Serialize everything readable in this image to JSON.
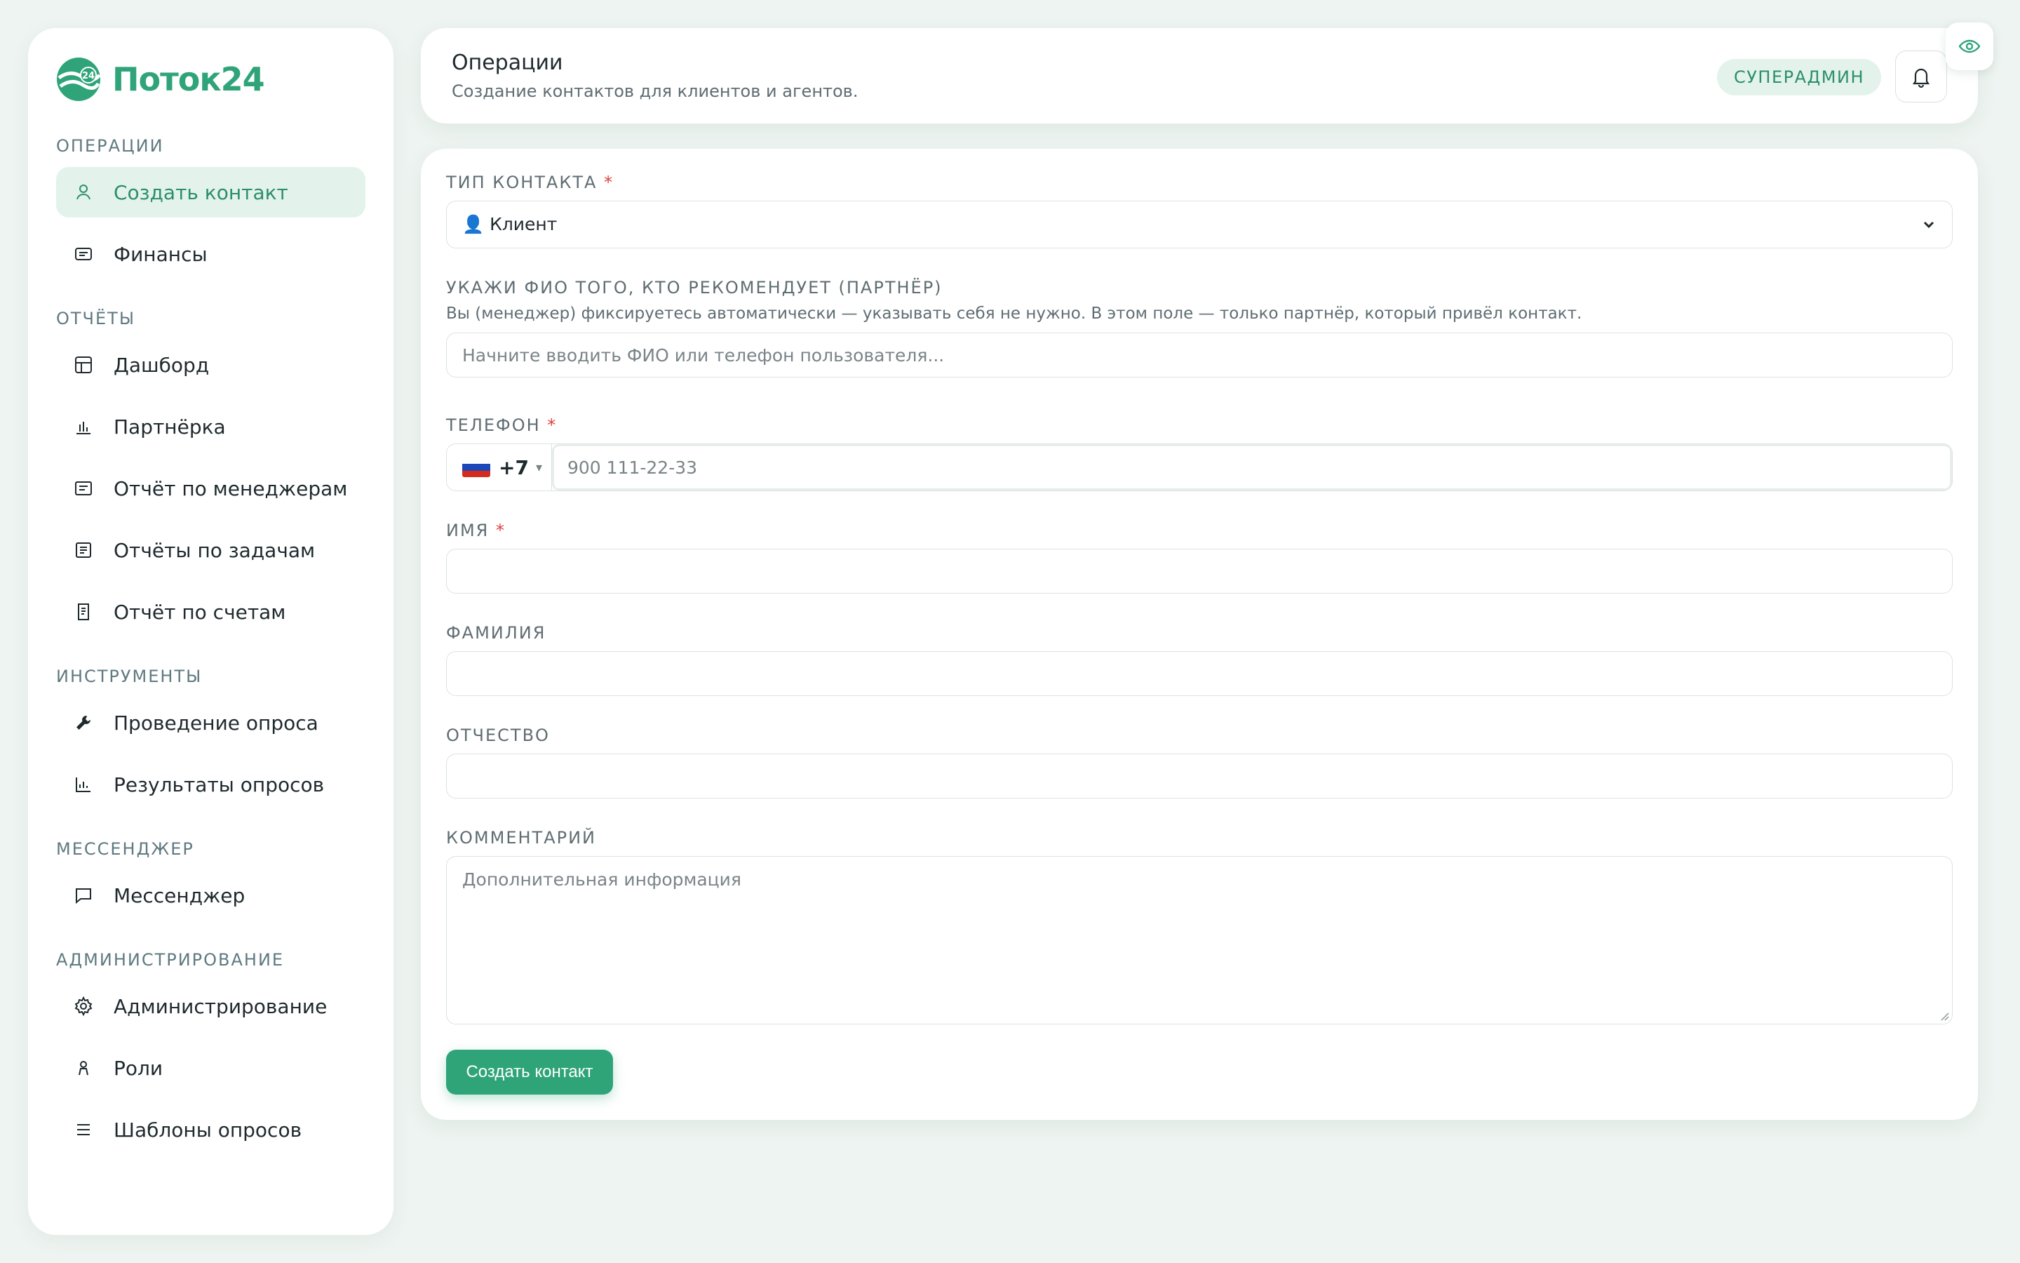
{
  "brand": {
    "name": "Поток24",
    "badge": "24",
    "color": "#2fa479"
  },
  "sidebar": {
    "sections": [
      {
        "title": "ОПЕРАЦИИ",
        "items": [
          {
            "label": "Создать контакт",
            "icon": "user-icon",
            "active": true
          },
          {
            "label": "Финансы",
            "icon": "wallet-icon"
          }
        ]
      },
      {
        "title": "ОТЧЁТЫ",
        "items": [
          {
            "label": "Дашборд",
            "icon": "table-icon"
          },
          {
            "label": "Партнёрка",
            "icon": "bar-chart-icon"
          },
          {
            "label": "Отчёт по менеджерам",
            "icon": "report-icon"
          },
          {
            "label": "Отчёты по задачам",
            "icon": "task-list-icon"
          },
          {
            "label": "Отчёт по счетам",
            "icon": "receipt-icon"
          }
        ]
      },
      {
        "title": "ИНСТРУМЕНТЫ",
        "items": [
          {
            "label": "Проведение опроса",
            "icon": "wrench-icon"
          },
          {
            "label": "Результаты опросов",
            "icon": "line-chart-icon"
          }
        ]
      },
      {
        "title": "МЕССЕНДЖЕР",
        "items": [
          {
            "label": "Мессенджер",
            "icon": "chat-icon"
          }
        ]
      },
      {
        "title": "АДМИНИСТРИРОВАНИЕ",
        "items": [
          {
            "label": "Администрирование",
            "icon": "gear-icon"
          },
          {
            "label": "Роли",
            "icon": "person-role-icon"
          },
          {
            "label": "Шаблоны опросов",
            "icon": "menu-lines-icon"
          }
        ]
      }
    ]
  },
  "header": {
    "title": "Операции",
    "subtitle": "Создание контактов для клиентов и агентов.",
    "role": "СУПЕРАДМИН"
  },
  "form": {
    "contact_type": {
      "label": "ТИП КОНТАКТА",
      "required": "*",
      "value": "👤 Клиент"
    },
    "referrer": {
      "label": "УКАЖИ ФИО ТОГО, КТО РЕКОМЕНДУЕТ (ПАРТНЁР)",
      "hint": "Вы (менеджер) фиксируетесь автоматически — указывать себя не нужно. В этом поле — только партнёр, который привёл контакт.",
      "placeholder": "Начните вводить ФИО или телефон пользователя..."
    },
    "phone": {
      "label": "ТЕЛЕФОН",
      "required": "*",
      "country_code": "+7",
      "caret": "▾",
      "placeholder": "900 111-22-33"
    },
    "first_name": {
      "label": "ИМЯ",
      "required": "*",
      "value": ""
    },
    "last_name": {
      "label": "ФАМИЛИЯ",
      "value": ""
    },
    "middle_name": {
      "label": "ОТЧЕСТВО",
      "value": ""
    },
    "comment": {
      "label": "КОММЕНТАРИЙ",
      "placeholder": "Дополнительная информация"
    },
    "submit": "Создать контакт"
  }
}
